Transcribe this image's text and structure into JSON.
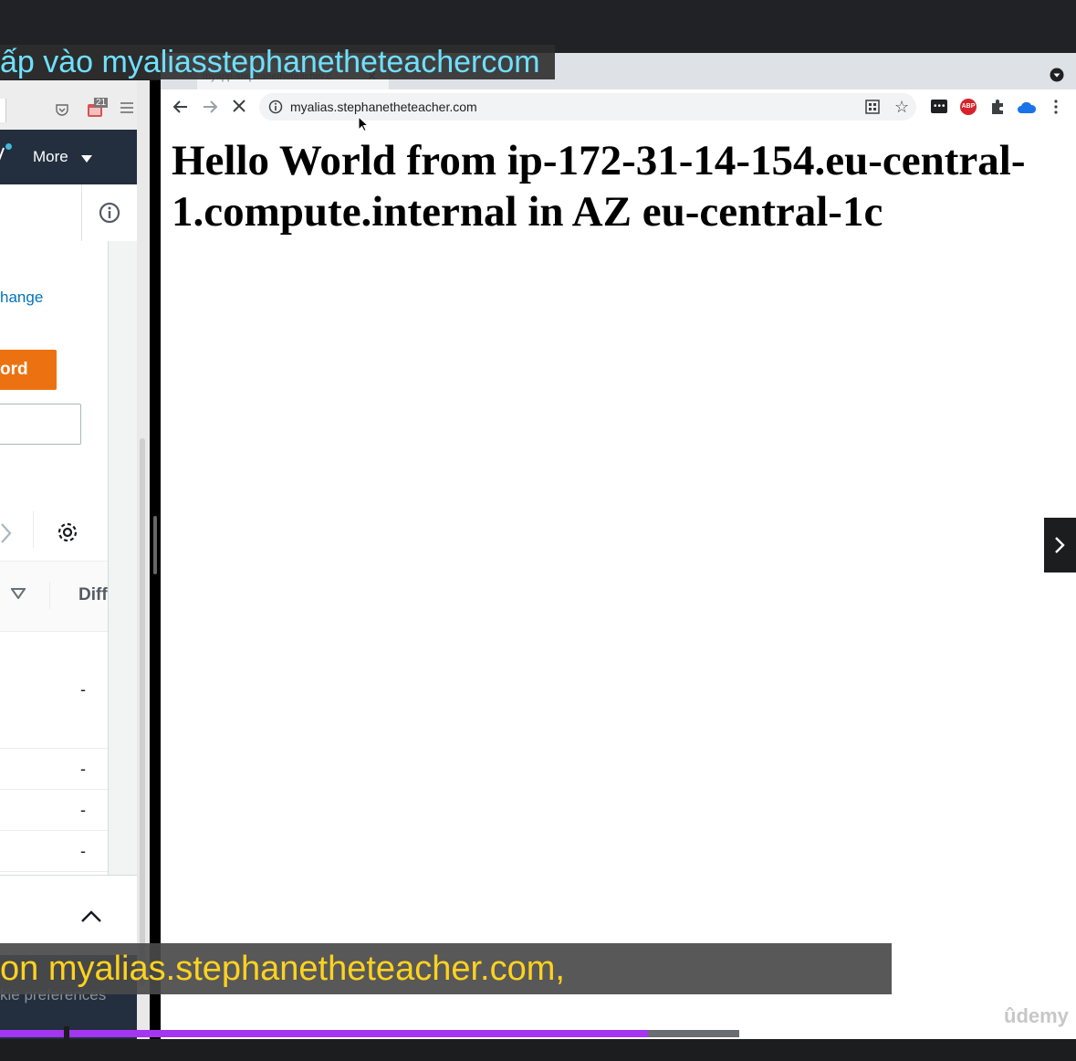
{
  "left_window": {
    "nav_more_label": "More",
    "change_link": "hange",
    "record_button_label": "ord",
    "table_header_diff": "Diff",
    "dash_values": [
      "-",
      "-",
      "-",
      "-"
    ],
    "cookie_text": "kie preferences",
    "tab_badge": "21"
  },
  "browser": {
    "faded_tab_title": "myapp.stephanetheteacher.c",
    "url": "myalias.stephanetheteacher.com",
    "page_heading": "Hello World from ip-172-31-14-154.eu-central-1.compute.internal in AZ eu-central-1c"
  },
  "video": {
    "subtitle_top": "ấp vào myaliasstephanetheteachercom",
    "subtitle_bottom": "on myalias.stephanetheteacher.com,",
    "progress": 0.877,
    "watermark": "ûdemy"
  },
  "colors": {
    "aws_nav": "#232f3e",
    "aws_orange": "#ec7211",
    "link_blue": "#0073bb",
    "subtitle_cyan": "#6fe0ff",
    "subtitle_yellow": "#ffd21f",
    "progress_purple": "#a435f0"
  },
  "icons": [
    "pocket-icon",
    "calendar-icon",
    "hamburger-icon",
    "notification-icon",
    "chevron-down-icon",
    "info-icon",
    "chevron-right-icon",
    "gear-icon",
    "sort-caret-icon",
    "chevron-up-icon",
    "back-arrow-icon",
    "forward-arrow-icon",
    "stop-loading-icon",
    "site-info-icon",
    "qr-code-icon",
    "star-icon",
    "extension-icon",
    "adblock-icon",
    "puzzle-icon",
    "cloud-icon",
    "kebab-menu-icon",
    "next-lecture-icon"
  ]
}
